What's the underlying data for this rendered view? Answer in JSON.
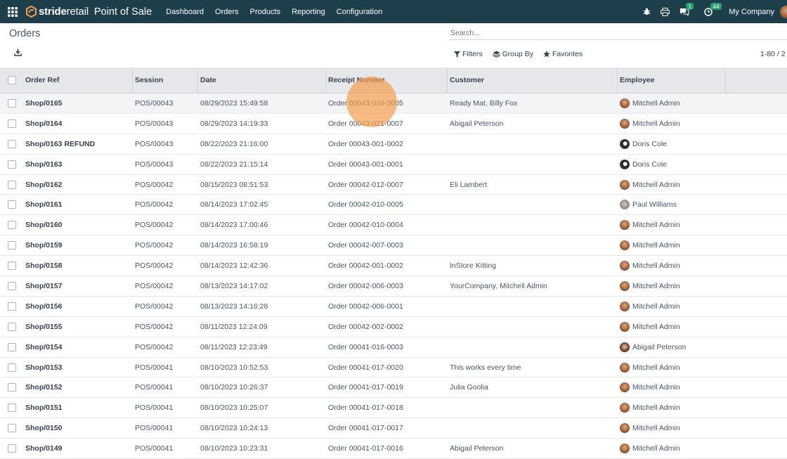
{
  "nav": {
    "logo_bold": "stride",
    "logo_light": "retail",
    "app_title": "Point of Sale",
    "menu": [
      "Dashboard",
      "Orders",
      "Products",
      "Reporting",
      "Configuration"
    ],
    "chat_badge": "1",
    "activity_badge": "44",
    "company": "My Company"
  },
  "control": {
    "breadcrumb": "Orders",
    "search_placeholder": "Search...",
    "filters_label": "Filters",
    "groupby_label": "Group By",
    "favorites_label": "Favorites",
    "pager": "1-80 / 2"
  },
  "table": {
    "columns": [
      "Order Ref",
      "Session",
      "Date",
      "Receipt Number",
      "Customer",
      "Employee"
    ],
    "rows": [
      {
        "ref": "Shop/0165",
        "session": "POS/00043",
        "date": "08/29/2023 15:49:58",
        "receipt": "Order 00043-010-0005",
        "customer": "Ready Mat, Billy Fox",
        "employee": "Mitchell Admin",
        "avatar": "mitchell"
      },
      {
        "ref": "Shop/0164",
        "session": "POS/00043",
        "date": "08/29/2023 14:19:33",
        "receipt": "Order 00043-021-0007",
        "customer": "Abigail Peterson",
        "employee": "Mitchell Admin",
        "avatar": "mitchell"
      },
      {
        "ref": "Shop/0163 REFUND",
        "session": "POS/00043",
        "date": "08/22/2023 21:16:00",
        "receipt": "Order 00043-001-0002",
        "customer": "",
        "employee": "Doris Cole",
        "avatar": "doris"
      },
      {
        "ref": "Shop/0163",
        "session": "POS/00043",
        "date": "08/22/2023 21:15:14",
        "receipt": "Order 00043-001-0001",
        "customer": "",
        "employee": "Doris Cole",
        "avatar": "doris"
      },
      {
        "ref": "Shop/0162",
        "session": "POS/00042",
        "date": "08/15/2023 08:51:53",
        "receipt": "Order 00042-012-0007",
        "customer": "Eli Lambert",
        "employee": "Mitchell Admin",
        "avatar": "mitchell"
      },
      {
        "ref": "Shop/0161",
        "session": "POS/00042",
        "date": "08/14/2023 17:02:45",
        "receipt": "Order 00042-010-0005",
        "customer": "",
        "employee": "Paul Williams",
        "avatar": "paul"
      },
      {
        "ref": "Shop/0160",
        "session": "POS/00042",
        "date": "08/14/2023 17:00:46",
        "receipt": "Order 00042-010-0004",
        "customer": "",
        "employee": "Mitchell Admin",
        "avatar": "mitchell"
      },
      {
        "ref": "Shop/0159",
        "session": "POS/00042",
        "date": "08/14/2023 16:58:19",
        "receipt": "Order 00042-007-0003",
        "customer": "",
        "employee": "Mitchell Admin",
        "avatar": "mitchell"
      },
      {
        "ref": "Shop/0158",
        "session": "POS/00042",
        "date": "08/14/2023 12:42:36",
        "receipt": "Order 00042-001-0002",
        "customer": "InStore Kitting",
        "employee": "Mitchell Admin",
        "avatar": "mitchell"
      },
      {
        "ref": "Shop/0157",
        "session": "POS/00042",
        "date": "08/13/2023 14:17:02",
        "receipt": "Order 00042-006-0003",
        "customer": "YourCompany, Mitchell Admin",
        "employee": "Mitchell Admin",
        "avatar": "mitchell"
      },
      {
        "ref": "Shop/0156",
        "session": "POS/00042",
        "date": "08/13/2023 14:16:28",
        "receipt": "Order 00042-006-0001",
        "customer": "",
        "employee": "Mitchell Admin",
        "avatar": "mitchell"
      },
      {
        "ref": "Shop/0155",
        "session": "POS/00042",
        "date": "08/11/2023 12:24:09",
        "receipt": "Order 00042-002-0002",
        "customer": "",
        "employee": "Mitchell Admin",
        "avatar": "mitchell"
      },
      {
        "ref": "Shop/0154",
        "session": "POS/00042",
        "date": "08/11/2023 12:23:49",
        "receipt": "Order 00041-016-0003",
        "customer": "",
        "employee": "Abigail Peterson",
        "avatar": "abigail"
      },
      {
        "ref": "Shop/0153",
        "session": "POS/00041",
        "date": "08/10/2023 10:52:53",
        "receipt": "Order 00041-017-0020",
        "customer": "This works every time",
        "employee": "Mitchell Admin",
        "avatar": "mitchell"
      },
      {
        "ref": "Shop/0152",
        "session": "POS/00041",
        "date": "08/10/2023 10:26:37",
        "receipt": "Order 00041-017-0019",
        "customer": "Julia Goolia",
        "employee": "Mitchell Admin",
        "avatar": "mitchell"
      },
      {
        "ref": "Shop/0151",
        "session": "POS/00041",
        "date": "08/10/2023 10:25:07",
        "receipt": "Order 00041-017-0018",
        "customer": "",
        "employee": "Mitchell Admin",
        "avatar": "mitchell"
      },
      {
        "ref": "Shop/0150",
        "session": "POS/00041",
        "date": "08/10/2023 10:24:13",
        "receipt": "Order 00041-017-0017",
        "customer": "",
        "employee": "Mitchell Admin",
        "avatar": "mitchell"
      },
      {
        "ref": "Shop/0149",
        "session": "POS/00041",
        "date": "08/10/2023 10:23:31",
        "receipt": "Order 00041-017-0016",
        "customer": "Abigail Peterson",
        "employee": "Mitchell Admin",
        "avatar": "mitchell"
      }
    ]
  },
  "colors": {
    "topbar": "#1d3f4c",
    "badge": "#22a06b",
    "header_bg": "#e5e7eb",
    "click_marker": "#f59e50"
  }
}
